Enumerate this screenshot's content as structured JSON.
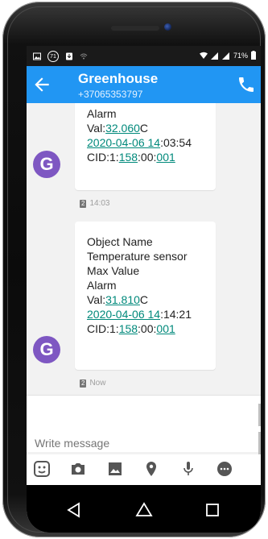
{
  "status_bar": {
    "notification_count": "71",
    "battery": "71%"
  },
  "app_bar": {
    "title": "Greenhouse",
    "subtitle": "+37065353797"
  },
  "messages": [
    {
      "avatar_letter": "G",
      "lines": [
        {
          "text": "Alarm"
        },
        {
          "parts": [
            {
              "t": "Val:"
            },
            {
              "t": "32.060",
              "link": true
            },
            {
              "t": "C"
            }
          ]
        },
        {
          "parts": [
            {
              "t": "2020-04-06 14",
              "link": true
            },
            {
              "t": ":03:54"
            }
          ]
        },
        {
          "parts": [
            {
              "t": "CID:1:"
            },
            {
              "t": "158",
              "link": true
            },
            {
              "t": ":00:"
            },
            {
              "t": "001",
              "link": true
            }
          ]
        }
      ],
      "sim": "2",
      "time": "14:03"
    },
    {
      "avatar_letter": "G",
      "lines": [
        {
          "text": "Object Name"
        },
        {
          "text": "Temperature sensor"
        },
        {
          "text": "Max Value"
        },
        {
          "text": "Alarm"
        },
        {
          "parts": [
            {
              "t": "Val:"
            },
            {
              "t": "31.810",
              "link": true
            },
            {
              "t": "C"
            }
          ]
        },
        {
          "parts": [
            {
              "t": "2020-04-06 14",
              "link": true
            },
            {
              "t": ":14:21"
            }
          ]
        },
        {
          "parts": [
            {
              "t": "CID:1:"
            },
            {
              "t": "158",
              "link": true
            },
            {
              "t": ":00:"
            },
            {
              "t": "001",
              "link": true
            }
          ]
        }
      ],
      "sim": "2",
      "time": "Now"
    }
  ],
  "compose": {
    "placeholder": "Write message"
  },
  "toolbar_icons": [
    "sticker-icon",
    "camera-icon",
    "gallery-icon",
    "location-icon",
    "microphone-icon",
    "more-icon"
  ],
  "nav_icons": [
    "back-triangle-icon",
    "home-icon",
    "recents-icon"
  ],
  "colors": {
    "app_bar": "#2196f3",
    "link": "#00897b",
    "avatar": "#7e57c2"
  }
}
